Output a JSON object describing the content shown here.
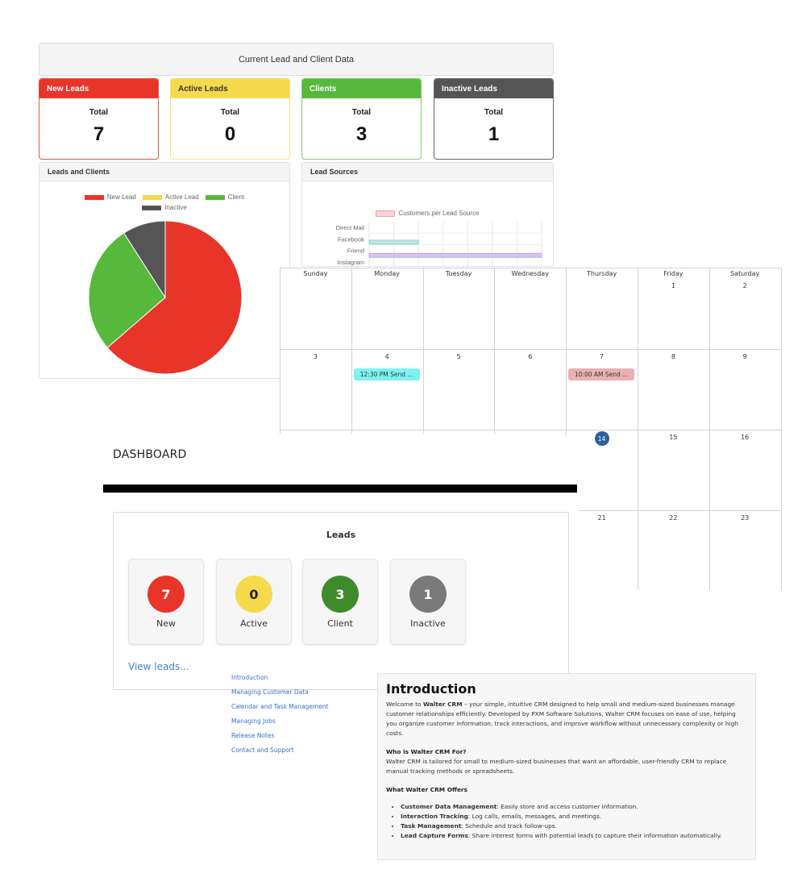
{
  "stats_panel": {
    "title": "Current Lead and Client Data",
    "cards": [
      {
        "label": "New Leads",
        "total_label": "Total",
        "value": "7"
      },
      {
        "label": "Active Leads",
        "total_label": "Total",
        "value": "0"
      },
      {
        "label": "Clients",
        "total_label": "Total",
        "value": "3"
      },
      {
        "label": "Inactive Leads",
        "total_label": "Total",
        "value": "1"
      }
    ],
    "colors": {
      "new": "#e7352a",
      "active": "#f7d94c",
      "client": "#57b93c",
      "inactive": "#555555"
    }
  },
  "chart_data": [
    {
      "type": "pie",
      "title": "Leads and Clients",
      "categories": [
        "New Lead",
        "Active Lead",
        "Client",
        "Inactive"
      ],
      "values": [
        7,
        0,
        3,
        1
      ],
      "colors": [
        "#e7352a",
        "#f7d94c",
        "#57b93c",
        "#555555"
      ],
      "legend": "top"
    },
    {
      "type": "bar",
      "orientation": "horizontal",
      "title": "Lead Sources",
      "legend_label": "Customers per Lead Source",
      "categories": [
        "Direct Mail",
        "Facebook",
        "Friend",
        "Instagram"
      ],
      "values": [
        0,
        1,
        3.5,
        0
      ],
      "bar_colors": [
        "#f4c6cc",
        "#bfe8e3",
        "#d6c4f2",
        "#f4c6cc"
      ],
      "xlim": [
        0,
        3.5
      ],
      "grid": true,
      "legend": "top"
    }
  ],
  "calendar": {
    "weekdays": [
      "Sunday",
      "Monday",
      "Tuesday",
      "Wednesday",
      "Thursday",
      "Friday",
      "Saturday"
    ],
    "weeks": [
      [
        "",
        "",
        "",
        "",
        "",
        "1",
        "2"
      ],
      [
        "3",
        "4",
        "5",
        "6",
        "7",
        "8",
        "9"
      ],
      [
        "",
        "",
        "",
        "",
        "14",
        "15",
        "16"
      ],
      [
        "",
        "",
        "",
        "",
        "21",
        "22",
        "23"
      ]
    ],
    "today": "14",
    "events": [
      {
        "day": "4",
        "label": "12:30 PM Send ...",
        "color": "#7ef3f0"
      },
      {
        "day": "7",
        "label": "10:00 AM Send ...",
        "color": "#eab1b2"
      }
    ]
  },
  "dashboard": {
    "title": "DASHBOARD",
    "leads_title": "Leads",
    "tiles": [
      {
        "value": "7",
        "label": "New",
        "color": "#e7352a"
      },
      {
        "value": "0",
        "label": "Active",
        "color": "#f7d94c"
      },
      {
        "value": "3",
        "label": "Client",
        "color": "#3f8a2a"
      },
      {
        "value": "1",
        "label": "Inactive",
        "color": "#7a7a7a"
      }
    ],
    "view_leads": "View leads..."
  },
  "help_nav": {
    "links": [
      "Introduction",
      "Managing Customer Data",
      "Calendar and Task Management",
      "Managing Jobs",
      "Release Notes",
      "Contact and Support"
    ]
  },
  "intro": {
    "heading": "Introduction",
    "p1_pre": "Welcome to ",
    "p1_bold": "Walter CRM",
    "p1_post": " – your simple, intuitive CRM designed to help small and medium-sized businesses manage customer relationships efficiently. Developed by PXM Software Solutions, Walter CRM focuses on ease of use, helping you organize customer information, track interactions, and improve workflow without unnecessary complexity or high costs.",
    "who_heading": "Who is Walter CRM For?",
    "who_text": "Walter CRM is tailored for small to medium-sized businesses that want an affordable, user-friendly CRM to replace manual tracking methods or spreadsheets.",
    "offers_heading": "What Walter CRM Offers",
    "offers": [
      {
        "title": "Customer Data Management",
        "text": ": Easily store and access customer information."
      },
      {
        "title": "Interaction Tracking",
        "text": ": Log calls, emails, messages, and meetings."
      },
      {
        "title": "Task Management",
        "text": ": Schedule and track follow-ups."
      },
      {
        "title": "Lead Capture Forms",
        "text": ": Share interest forms with potential leads to capture their information automatically."
      }
    ]
  }
}
